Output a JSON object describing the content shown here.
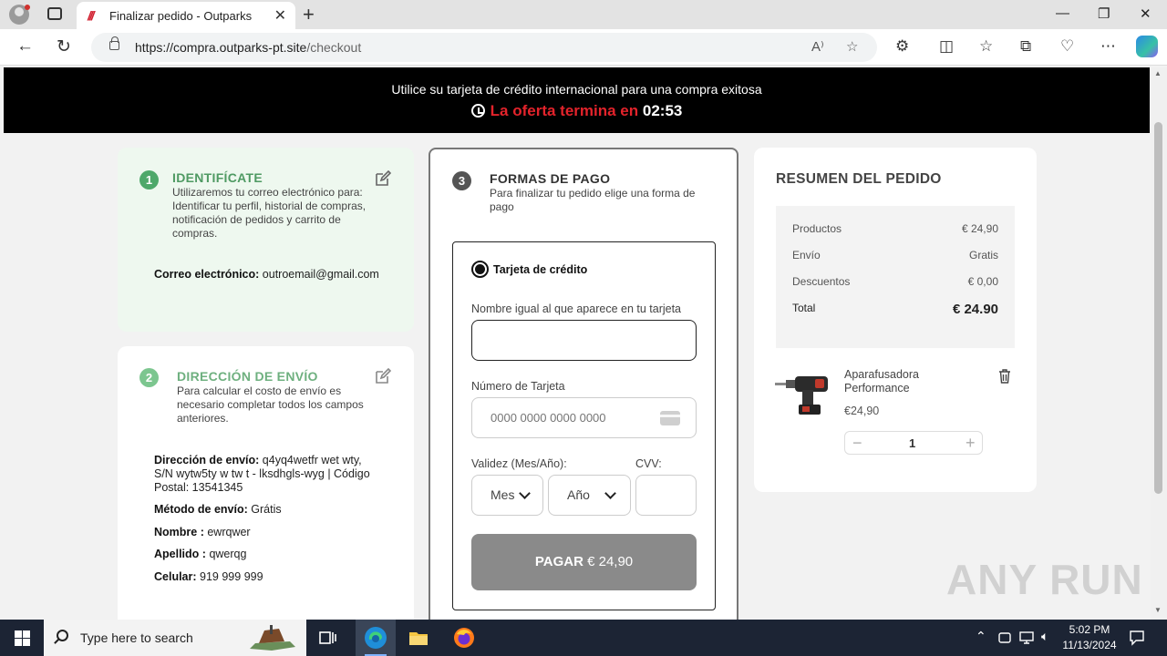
{
  "browser": {
    "tab_title": "Finalizar pedido - Outparks",
    "tab_favicon": "///",
    "url_domain": "https://compra.outparks-pt.site",
    "url_path": "/checkout"
  },
  "banner": {
    "line1": "Utilice su tarjeta de crédito internacional para una compra exitosa",
    "offer_label": "La oferta termina en",
    "countdown": "02:53"
  },
  "identify": {
    "step": "1",
    "title": "IDENTIFÍCATE",
    "desc": "Utilizaremos tu correo electrónico para: Identificar tu perfil, historial de compras, notificación de pedidos y carrito de compras.",
    "email_label": "Correo electrónico:",
    "email_value": "outroemail@gmail.com"
  },
  "shipping": {
    "step": "2",
    "title": "DIRECCIÓN DE ENVÍO",
    "desc": "Para calcular el costo de envío es necesario completar todos los campos anteriores.",
    "address_label": "Dirección de envío:",
    "address_value": "q4yq4wetfr wet wty, S/N wytw5ty w tw t - lksdhgls-wyg | Código Postal: 13541345",
    "method_label": "Método de envío:",
    "method_value": "Grátis",
    "name_label": "Nombre :",
    "name_value": "ewrqwer",
    "surname_label": "Apellido :",
    "surname_value": "qwerqg",
    "phone_label": "Celular:",
    "phone_value": "919 999 999"
  },
  "payment": {
    "step": "3",
    "title": "FORMAS DE PAGO",
    "desc": "Para finalizar tu pedido elige una forma de pago",
    "method_label": "Tarjeta de crédito",
    "name_label": "Nombre igual al que aparece en tu tarjeta",
    "name_value": "",
    "card_label": "Número de Tarjeta",
    "card_placeholder": "0000 0000 0000 0000",
    "validity_label": "Validez (Mes/Año):",
    "cvv_label": "CVV:",
    "month_value": "Mes",
    "year_value": "Año",
    "pay_word": "PAGAR",
    "pay_amount": "€ 24,90"
  },
  "summary": {
    "title": "RESUMEN DEL PEDIDO",
    "rows": [
      {
        "label": "Productos",
        "value": "€ 24,90"
      },
      {
        "label": "Envío",
        "value": "Gratis"
      },
      {
        "label": "Descuentos",
        "value": "€ 0,00"
      }
    ],
    "total_label": "Total",
    "total_value": "€ 24.90",
    "product_name": "Aparafusadora Performance",
    "product_price": "€24,90",
    "quantity": "1"
  },
  "watermark": "ANY RUN",
  "taskbar": {
    "search_placeholder": "Type here to search",
    "time": "5:02 PM",
    "date": "11/13/2024"
  },
  "colors": {
    "step_green": "#4ea86a",
    "title_green": "#4f9a63",
    "offer_red": "#e3232b",
    "pay_button": "#8a8a8a"
  }
}
